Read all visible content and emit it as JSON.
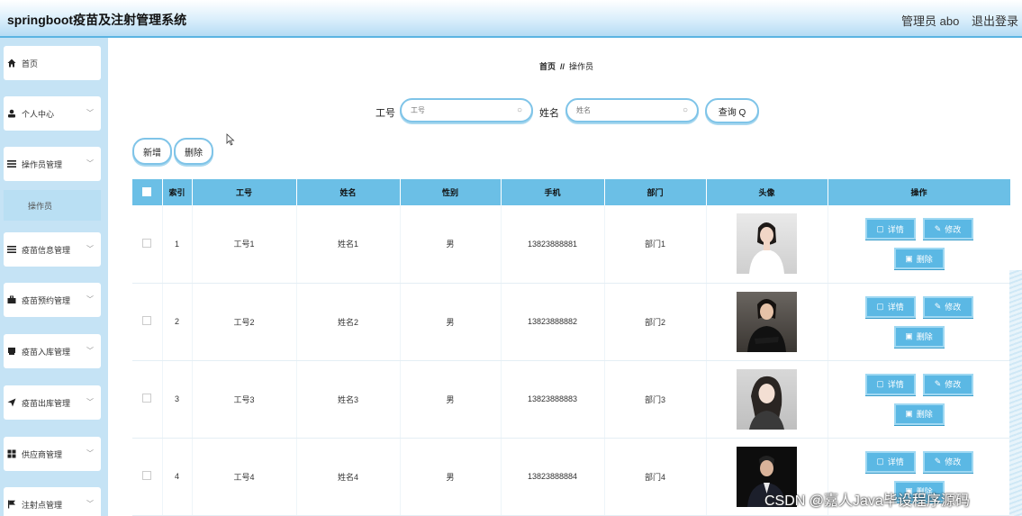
{
  "header": {
    "title": "springboot疫苗及注射管理系统",
    "admin": "管理员 abo",
    "logout": "退出登录"
  },
  "sidebar": {
    "items": [
      {
        "label": "首页",
        "icon": "home-icon"
      },
      {
        "label": "个人中心",
        "icon": "user-icon"
      },
      {
        "label": "操作员管理",
        "icon": "list-icon"
      },
      {
        "label": "疫苗信息管理",
        "icon": "list-icon"
      },
      {
        "label": "疫苗预约管理",
        "icon": "briefcase-icon"
      },
      {
        "label": "疫苗入库管理",
        "icon": "box-icon"
      },
      {
        "label": "疫苗出库管理",
        "icon": "send-icon"
      },
      {
        "label": "供应商管理",
        "icon": "grid-icon"
      },
      {
        "label": "注射点管理",
        "icon": "flag-icon"
      }
    ],
    "sub": "操作员"
  },
  "breadcrumb": {
    "home": "首页",
    "sep": "//",
    "current": "操作员"
  },
  "search": {
    "label1": "工号",
    "placeholder1": "工号",
    "label2": "姓名",
    "placeholder2": "姓名",
    "button": "查询 Q"
  },
  "toolbar": {
    "add": "新增",
    "delete": "删除"
  },
  "table": {
    "headers": [
      "",
      "索引",
      "工号",
      "姓名",
      "性别",
      "手机",
      "部门",
      "头像",
      "操作"
    ],
    "rows": [
      {
        "index": "1",
        "id": "工号1",
        "name": "姓名1",
        "gender": "男",
        "phone": "13823888881",
        "dept": "部门1"
      },
      {
        "index": "2",
        "id": "工号2",
        "name": "姓名2",
        "gender": "男",
        "phone": "13823888882",
        "dept": "部门2"
      },
      {
        "index": "3",
        "id": "工号3",
        "name": "姓名3",
        "gender": "男",
        "phone": "13823888883",
        "dept": "部门3"
      },
      {
        "index": "4",
        "id": "工号4",
        "name": "姓名4",
        "gender": "男",
        "phone": "13823888884",
        "dept": "部门4"
      }
    ],
    "actions": {
      "detail": "详情",
      "edit": "修改",
      "delete": "删除"
    }
  },
  "watermark": "CSDN @嘉人Java毕设程序源码",
  "colors": {
    "accent": "#6bbfe6",
    "sidebar_bg": "#c5e3f5",
    "button": "#5bb8e4"
  }
}
